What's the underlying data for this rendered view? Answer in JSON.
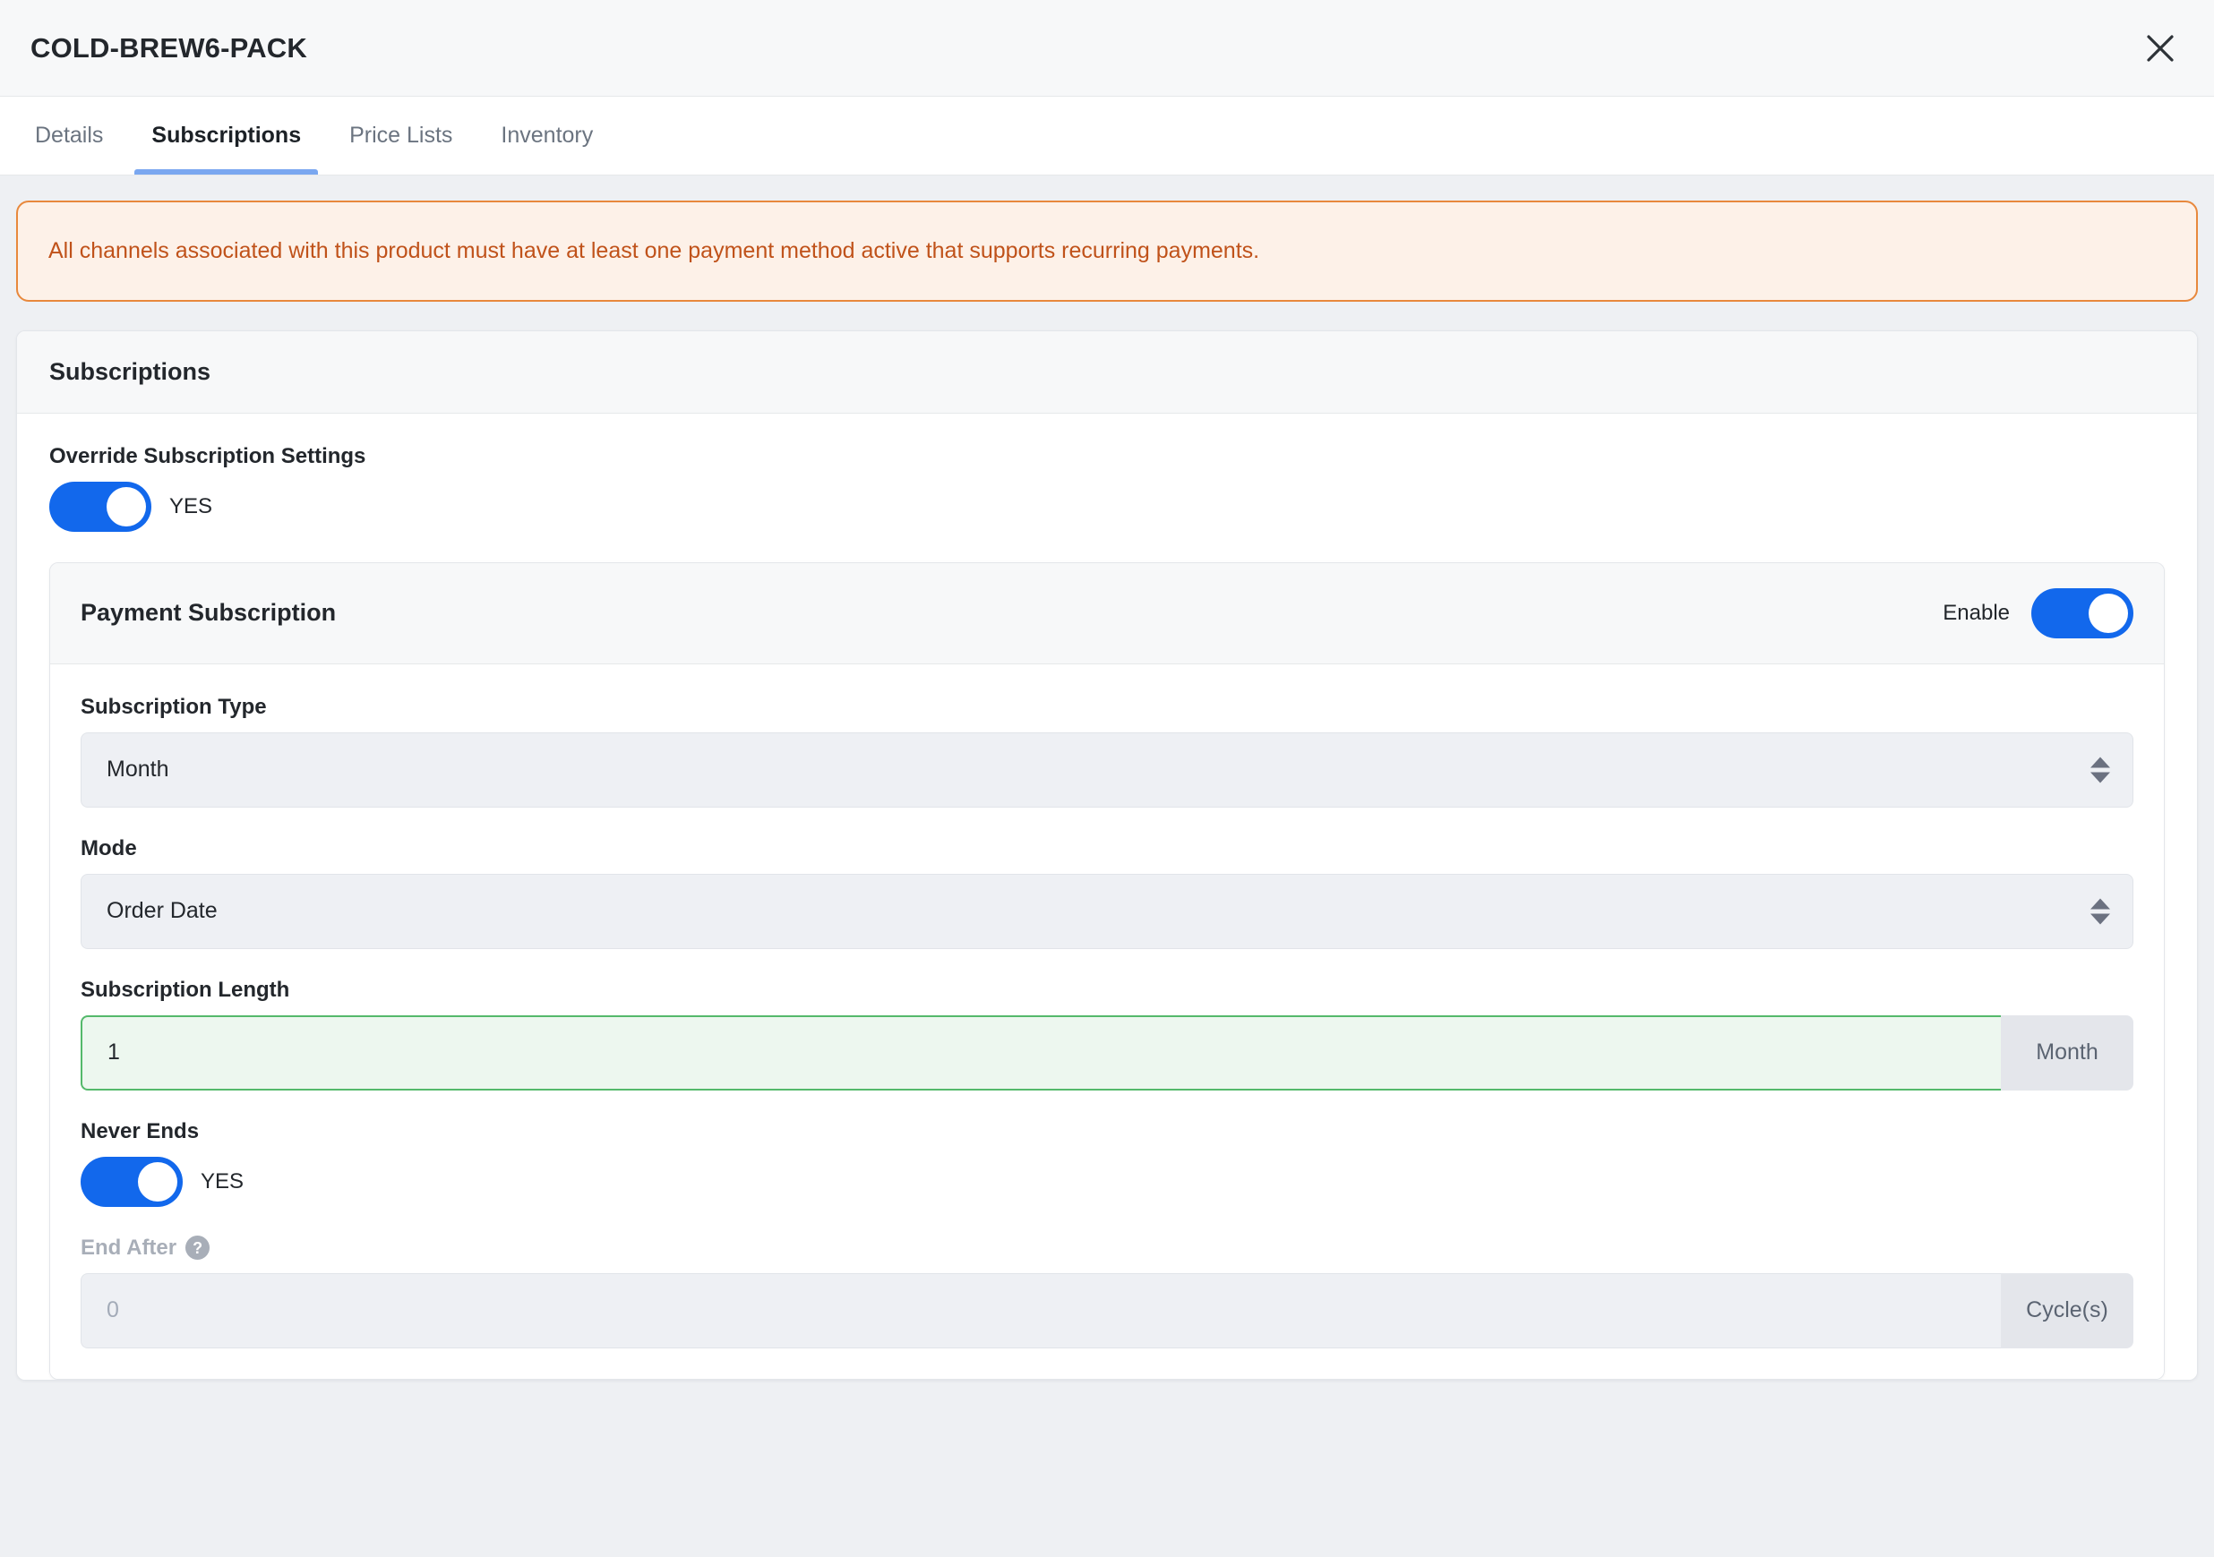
{
  "modal": {
    "title": "COLD-BREW6-PACK",
    "close_icon": "close-icon"
  },
  "tabs": [
    {
      "label": "Details",
      "active": false
    },
    {
      "label": "Subscriptions",
      "active": true
    },
    {
      "label": "Price Lists",
      "active": false
    },
    {
      "label": "Inventory",
      "active": false
    }
  ],
  "banner": {
    "text": "All channels associated with this product must have at least one payment method active that supports recurring payments.",
    "border_color": "#e8883c",
    "background_color": "#fdf1e8",
    "text_color": "#c0521a"
  },
  "panel": {
    "header_title": "Subscriptions",
    "override": {
      "label": "Override Subscription Settings",
      "state_label": "YES",
      "on": true
    }
  },
  "payment_subscription": {
    "title": "Payment Subscription",
    "enable_label": "Enable",
    "enable_on": true,
    "subscription_type": {
      "label": "Subscription Type",
      "value": "Month"
    },
    "mode": {
      "label": "Mode",
      "value": "Order Date"
    },
    "subscription_length": {
      "label": "Subscription Length",
      "value": "1",
      "addon": "Month"
    },
    "never_ends": {
      "label": "Never Ends",
      "state_label": "YES",
      "on": true
    },
    "end_after": {
      "label": "End After",
      "help_icon": "?",
      "value": "0",
      "addon": "Cycle(s)",
      "disabled": true
    }
  },
  "theme": {
    "toggle_on_color": "#1268ec",
    "active_tab_underline": "#7aa7f0",
    "valid_border": "#54b96b",
    "valid_bg": "#edf7ef"
  }
}
